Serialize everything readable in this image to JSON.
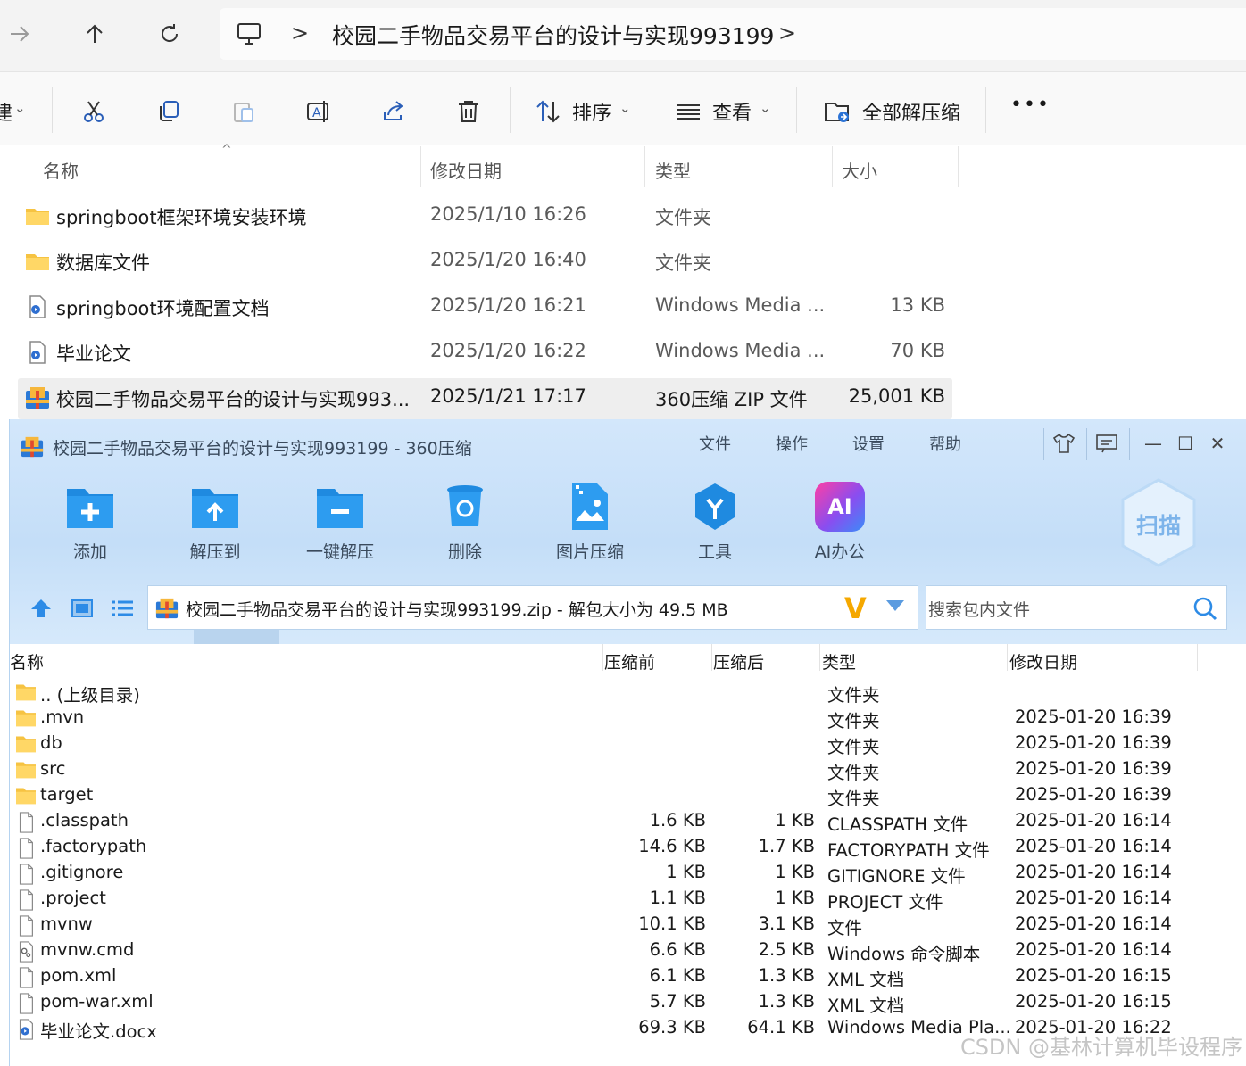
{
  "explorer": {
    "address": {
      "path_title": "校园二手物品交易平台的设计与实现993199",
      "separator": ">",
      "icons": [
        "forward-icon",
        "up-icon",
        "refresh-icon",
        "computer-icon"
      ]
    },
    "toolbar": {
      "new_partial": "建",
      "sort_label": "排序",
      "view_label": "查看",
      "extract_all_label": "全部解压缩",
      "more_label": "•••"
    },
    "columns": {
      "name": "名称",
      "modified": "修改日期",
      "type": "类型",
      "size": "大小"
    },
    "files": [
      {
        "name": "springboot框架环境安装环境",
        "date": "2025/1/10 16:26",
        "type": "文件夹",
        "size": "",
        "icon": "folder-icon"
      },
      {
        "name": "数据库文件",
        "date": "2025/1/20 16:40",
        "type": "文件夹",
        "size": "",
        "icon": "folder-icon"
      },
      {
        "name": "springboot环境配置文档",
        "date": "2025/1/20 16:21",
        "type": "Windows Media ...",
        "size": "13 KB",
        "icon": "media-file-icon"
      },
      {
        "name": "毕业论文",
        "date": "2025/1/20 16:22",
        "type": "Windows Media ...",
        "size": "70 KB",
        "icon": "media-file-icon"
      },
      {
        "name": "校园二手物品交易平台的设计与实现993...",
        "date": "2025/1/21 17:17",
        "type": "360压缩 ZIP 文件",
        "size": "25,001 KB",
        "icon": "zip-archive-icon",
        "selected": true
      }
    ]
  },
  "zip": {
    "title": "校园二手物品交易平台的设计与实现993199 - 360压缩",
    "menu": [
      "文件",
      "操作",
      "设置",
      "帮助"
    ],
    "window_controls": {
      "minimize": "—",
      "maximize": "☐",
      "close": "✕"
    },
    "tools": [
      {
        "label": "添加",
        "icon": "add-folder-icon"
      },
      {
        "label": "解压到",
        "icon": "extract-to-icon"
      },
      {
        "label": "一键解压",
        "icon": "one-click-extract-icon"
      },
      {
        "label": "删除",
        "icon": "delete-bin-icon"
      },
      {
        "label": "图片压缩",
        "icon": "image-compress-icon"
      },
      {
        "label": "工具",
        "icon": "tools-icon"
      },
      {
        "label": "AI办公",
        "icon": "ai-office-icon"
      }
    ],
    "ai_badge": "AI",
    "scan_label": "扫描",
    "path_text": "校园二手物品交易平台的设计与实现993199.zip - 解包大小为 49.5 MB",
    "path_badge": "V",
    "search_placeholder": "搜索包内文件",
    "columns": {
      "name": "名称",
      "before": "压缩前",
      "after": "压缩后",
      "type": "类型",
      "modified": "修改日期"
    },
    "rows": [
      {
        "name": ".. (上级目录)",
        "before": "",
        "after": "",
        "type": "文件夹",
        "date": "",
        "icon": "folder-icon"
      },
      {
        "name": ".mvn",
        "before": "",
        "after": "",
        "type": "文件夹",
        "date": "2025-01-20 16:39",
        "icon": "folder-icon"
      },
      {
        "name": "db",
        "before": "",
        "after": "",
        "type": "文件夹",
        "date": "2025-01-20 16:39",
        "icon": "folder-icon"
      },
      {
        "name": "src",
        "before": "",
        "after": "",
        "type": "文件夹",
        "date": "2025-01-20 16:39",
        "icon": "folder-icon"
      },
      {
        "name": "target",
        "before": "",
        "after": "",
        "type": "文件夹",
        "date": "2025-01-20 16:39",
        "icon": "folder-icon"
      },
      {
        "name": ".classpath",
        "before": "1.6 KB",
        "after": "1 KB",
        "type": "CLASSPATH 文件",
        "date": "2025-01-20 16:14",
        "icon": "file-icon"
      },
      {
        "name": ".factorypath",
        "before": "14.6 KB",
        "after": "1.7 KB",
        "type": "FACTORYPATH 文件",
        "date": "2025-01-20 16:14",
        "icon": "file-icon"
      },
      {
        "name": ".gitignore",
        "before": "1 KB",
        "after": "1 KB",
        "type": "GITIGNORE 文件",
        "date": "2025-01-20 16:14",
        "icon": "file-icon"
      },
      {
        "name": ".project",
        "before": "1.1 KB",
        "after": "1 KB",
        "type": "PROJECT 文件",
        "date": "2025-01-20 16:14",
        "icon": "file-icon"
      },
      {
        "name": "mvnw",
        "before": "10.1 KB",
        "after": "3.1 KB",
        "type": "文件",
        "date": "2025-01-20 16:14",
        "icon": "file-icon"
      },
      {
        "name": "mvnw.cmd",
        "before": "6.6 KB",
        "after": "2.5 KB",
        "type": "Windows 命令脚本",
        "date": "2025-01-20 16:14",
        "icon": "cmd-script-icon"
      },
      {
        "name": "pom.xml",
        "before": "6.1 KB",
        "after": "1.3 KB",
        "type": "XML 文档",
        "date": "2025-01-20 16:15",
        "icon": "file-icon"
      },
      {
        "name": "pom-war.xml",
        "before": "5.7 KB",
        "after": "1.3 KB",
        "type": "XML 文档",
        "date": "2025-01-20 16:15",
        "icon": "file-icon"
      },
      {
        "name": "毕业论文.docx",
        "before": "69.3 KB",
        "after": "64.1 KB",
        "type": "Windows Media Pla...",
        "date": "2025-01-20 16:22",
        "icon": "media-file-icon"
      }
    ]
  },
  "watermark": "CSDN @基林计算机毕设程序",
  "colors": {
    "folder": "#f6c342",
    "zip_accent": "#1f8ae0",
    "zip_header_bg": "#c9e1f9",
    "selected_row": "#eeeeee"
  }
}
